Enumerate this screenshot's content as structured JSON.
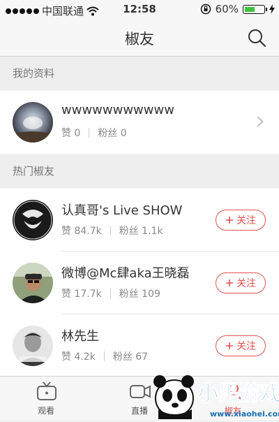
{
  "status_bar": {
    "carrier": "中国联通",
    "time": "12:58",
    "battery_percent": "60%",
    "battery_level": 0.6,
    "icons": [
      "signal-dots-icon",
      "wifi-icon",
      "rotation-lock-icon",
      "battery-icon",
      "charging-icon"
    ]
  },
  "nav": {
    "title": "椒友",
    "search_icon": "search-icon"
  },
  "my_profile": {
    "section_title": "我的资料",
    "name": "wwwwwwwwwww",
    "likes_label": "赞 0",
    "fans_label": "粉丝 0"
  },
  "popular": {
    "section_title": "热门椒友",
    "users": [
      {
        "name": "认真哥's Live SHOW",
        "likes_label": "赞 84.7k",
        "fans_label": "粉丝 1.1k",
        "follow_label": "关注"
      },
      {
        "name": "微博@Mc肆aka王晓磊",
        "likes_label": "赞 17.7k",
        "fans_label": "粉丝 109",
        "follow_label": "关注"
      },
      {
        "name": "林先生",
        "likes_label": "赞 4.2k",
        "fans_label": "粉丝 67",
        "follow_label": "关注"
      }
    ]
  },
  "tabbar": {
    "tabs": [
      {
        "label": "观看",
        "icon": "tv-icon"
      },
      {
        "label": "直播",
        "icon": "camera-icon"
      },
      {
        "label": "椒友",
        "icon": "friends-icon"
      }
    ]
  },
  "watermark": {
    "text": "小黑游戏",
    "url_text": "www.xiaohei.com"
  },
  "colors": {
    "accent": "#e05050",
    "section_bg": "#eeeeee",
    "bar_bg": "#f7f7f7"
  }
}
